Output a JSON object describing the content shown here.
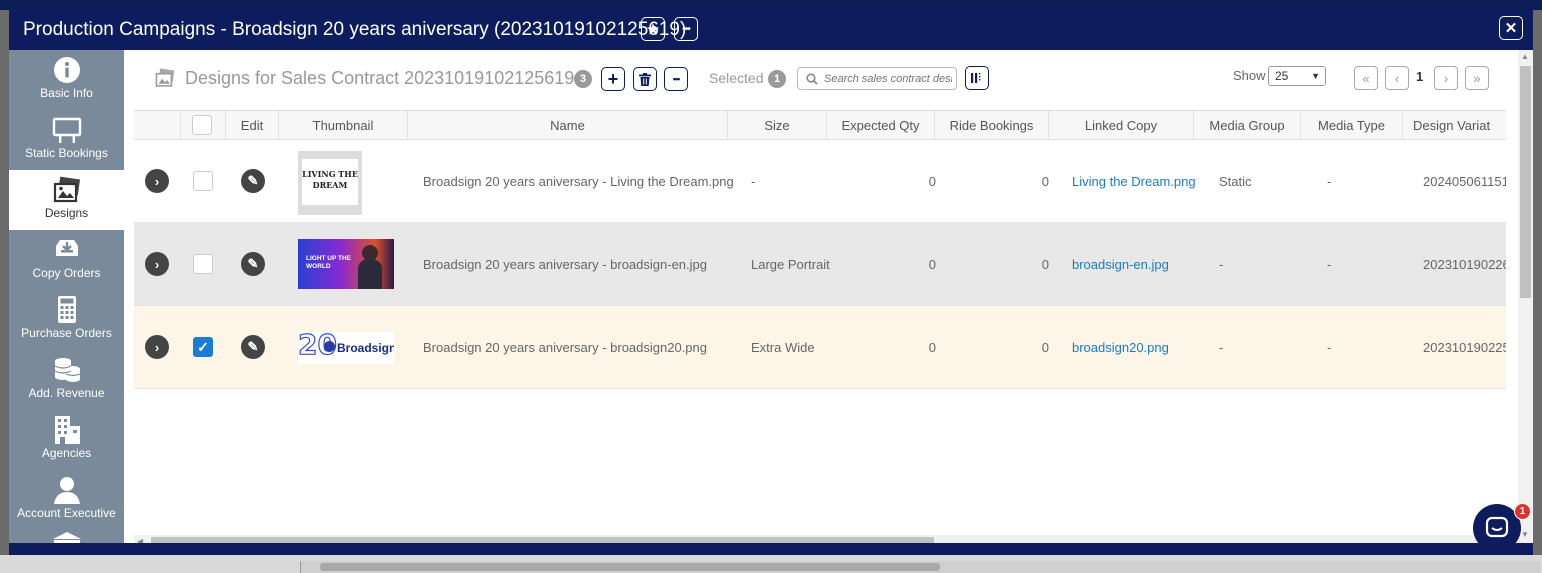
{
  "window": {
    "title": "Production Campaigns - Broadsign 20 years aniversary (20231019102125619)",
    "star_label": "★",
    "more_label": "•••",
    "close_label": "✕"
  },
  "sidebar": {
    "items": [
      {
        "label": "Basic Info",
        "icon": "info-icon"
      },
      {
        "label": "Static Bookings",
        "icon": "billboard-icon"
      },
      {
        "label": "Designs",
        "icon": "images-icon"
      },
      {
        "label": "Copy Orders",
        "icon": "inbox-download-icon"
      },
      {
        "label": "Purchase Orders",
        "icon": "calculator-icon"
      },
      {
        "label": "Add. Revenue",
        "icon": "coins-icon"
      },
      {
        "label": "Agencies",
        "icon": "building-icon"
      },
      {
        "label": "Account Executive",
        "icon": "user-icon"
      }
    ]
  },
  "toolbar": {
    "title": "Designs for Sales Contract 20231019102125619",
    "count": "3",
    "add_label": "+",
    "more_label": "•••",
    "selected_label": "Selected",
    "selected_count": "1",
    "search_placeholder": "Search sales contract desi",
    "show_label": "Show",
    "show_value": "25",
    "page": "1",
    "first_label": "«",
    "prev_label": "‹",
    "next_label": "›",
    "last_label": "»"
  },
  "table": {
    "columns": [
      "Edit",
      "Thumbnail",
      "Name",
      "Size",
      "Expected Qty",
      "Ride Bookings",
      "Linked Copy",
      "Media Group",
      "Media Type",
      "Design Variat"
    ],
    "rows": [
      {
        "name": "Broadsign 20 years aniversary - Living the Dream.png",
        "size": "-",
        "expected_qty": "0",
        "ride_bookings": "0",
        "linked_copy": "Living the Dream.png",
        "media_group": "Static",
        "media_type": "-",
        "design_variation": "202405061151",
        "checked": false,
        "thumb_text": "LIVING THE DREAM"
      },
      {
        "name": "Broadsign 20 years aniversary - broadsign-en.jpg",
        "size": "Large Portrait",
        "expected_qty": "0",
        "ride_bookings": "0",
        "linked_copy": "broadsign-en.jpg",
        "media_group": "-",
        "media_type": "-",
        "design_variation": "202310190226",
        "checked": false,
        "thumb_text": "LIGHT UP THE WORLD"
      },
      {
        "name": "Broadsign 20 years aniversary - broadsign20.png",
        "size": "Extra Wide",
        "expected_qty": "0",
        "ride_bookings": "0",
        "linked_copy": "broadsign20.png",
        "media_group": "-",
        "media_type": "-",
        "design_variation": "202310190225",
        "checked": true,
        "thumb_text": "Broadsign"
      }
    ]
  },
  "chat": {
    "badge": "1"
  },
  "colors": {
    "navy": "#0c1c5c",
    "sidebar": "#7a8a9a",
    "link": "#1a7dc4",
    "row_alt": "#e8e8e8",
    "row_selected": "#fdf5e8"
  }
}
